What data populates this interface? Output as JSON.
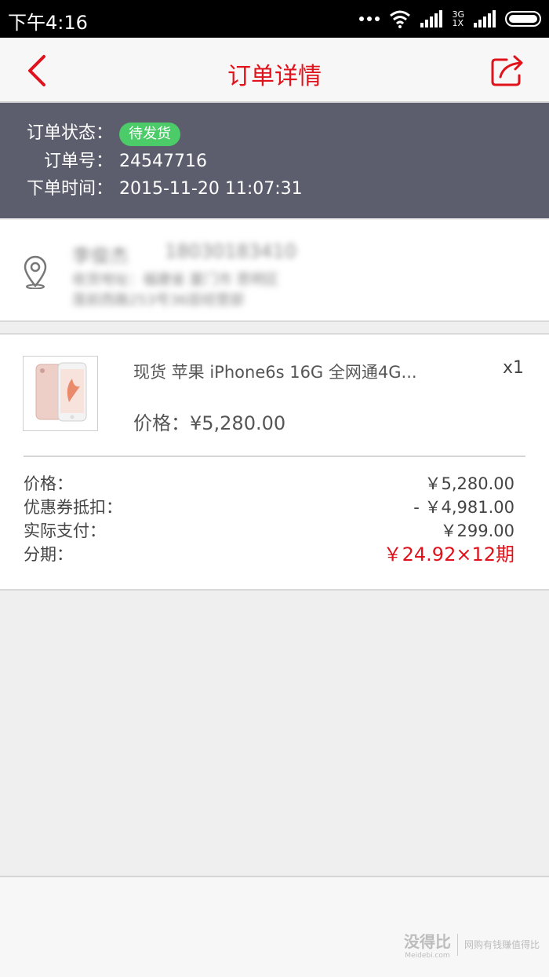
{
  "status_bar": {
    "time": "下午4:16",
    "network_top": "3G",
    "network_bottom": "1X"
  },
  "navbar": {
    "title": "订单详情",
    "back_icon": "chevron-left-icon",
    "share_icon": "share-icon",
    "accent": "#e0121b"
  },
  "order": {
    "status_label": "订单状态：",
    "status_value": "待发货",
    "number_label": "订单号：",
    "number_value": "24547716",
    "time_label": "下单时间：",
    "time_value": "2015-11-20 11:07:31"
  },
  "address": {
    "pin_icon": "location-pin-icon",
    "name": "李俊杰",
    "phone": "18030183410",
    "line1": "收货地址：福建省 厦门市 思明区",
    "line2": "莲前西路253号36层经营部"
  },
  "product": {
    "name": "现货 苹果 iPhone6s 16G 全网通4G...",
    "qty": "x1",
    "price": "价格：¥5,280.00"
  },
  "summary": {
    "price_label": "价格：",
    "price_value": "￥5,280.00",
    "coupon_label": "优惠券抵扣：",
    "coupon_value": "- ￥4,981.00",
    "paid_label": "实际支付：",
    "paid_value": "￥299.00",
    "installment_label": "分期：",
    "installment_value": "￥24.92×12期"
  },
  "watermark": {
    "brand": "没得比",
    "domain": "Meidebi.com",
    "slogan": "网购有钱赚值得比"
  }
}
